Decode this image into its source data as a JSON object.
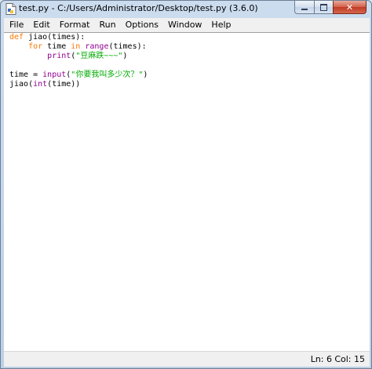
{
  "window": {
    "title": "test.py - C:/Users/Administrator/Desktop/test.py (3.6.0)",
    "minimize_icon": "minimize-icon",
    "maximize_icon": "maximize-icon",
    "close_icon": "close-icon",
    "close_glyph": "✕",
    "app_icon": "python-file-icon"
  },
  "menu": {
    "items": [
      {
        "label": "File"
      },
      {
        "label": "Edit"
      },
      {
        "label": "Format"
      },
      {
        "label": "Run"
      },
      {
        "label": "Options"
      },
      {
        "label": "Window"
      },
      {
        "label": "Help"
      }
    ]
  },
  "editor": {
    "lines": [
      [
        {
          "t": "def",
          "c": "kw"
        },
        {
          "t": " jiao(times):",
          "c": ""
        }
      ],
      [
        {
          "t": "    ",
          "c": ""
        },
        {
          "t": "for",
          "c": "kw"
        },
        {
          "t": " time ",
          "c": ""
        },
        {
          "t": "in",
          "c": "kw"
        },
        {
          "t": " ",
          "c": ""
        },
        {
          "t": "range",
          "c": "bi"
        },
        {
          "t": "(times):",
          "c": ""
        }
      ],
      [
        {
          "t": "        ",
          "c": ""
        },
        {
          "t": "print",
          "c": "bi"
        },
        {
          "t": "(",
          "c": ""
        },
        {
          "t": "\"豆麻跌~~~\"",
          "c": "st"
        },
        {
          "t": ")",
          "c": ""
        }
      ],
      [],
      [
        {
          "t": "time = ",
          "c": ""
        },
        {
          "t": "input",
          "c": "bi"
        },
        {
          "t": "(",
          "c": ""
        },
        {
          "t": "\"你要我叫多少次？\"",
          "c": "st"
        },
        {
          "t": ")",
          "c": ""
        }
      ],
      [
        {
          "t": "jiao(",
          "c": ""
        },
        {
          "t": "int",
          "c": "bi"
        },
        {
          "t": "(time))",
          "c": ""
        }
      ]
    ]
  },
  "status": {
    "line": "Ln: 6",
    "col": "Col: 15"
  },
  "colors": {
    "keyword": "#ff7700",
    "builtin": "#900090",
    "string": "#00aa00"
  }
}
